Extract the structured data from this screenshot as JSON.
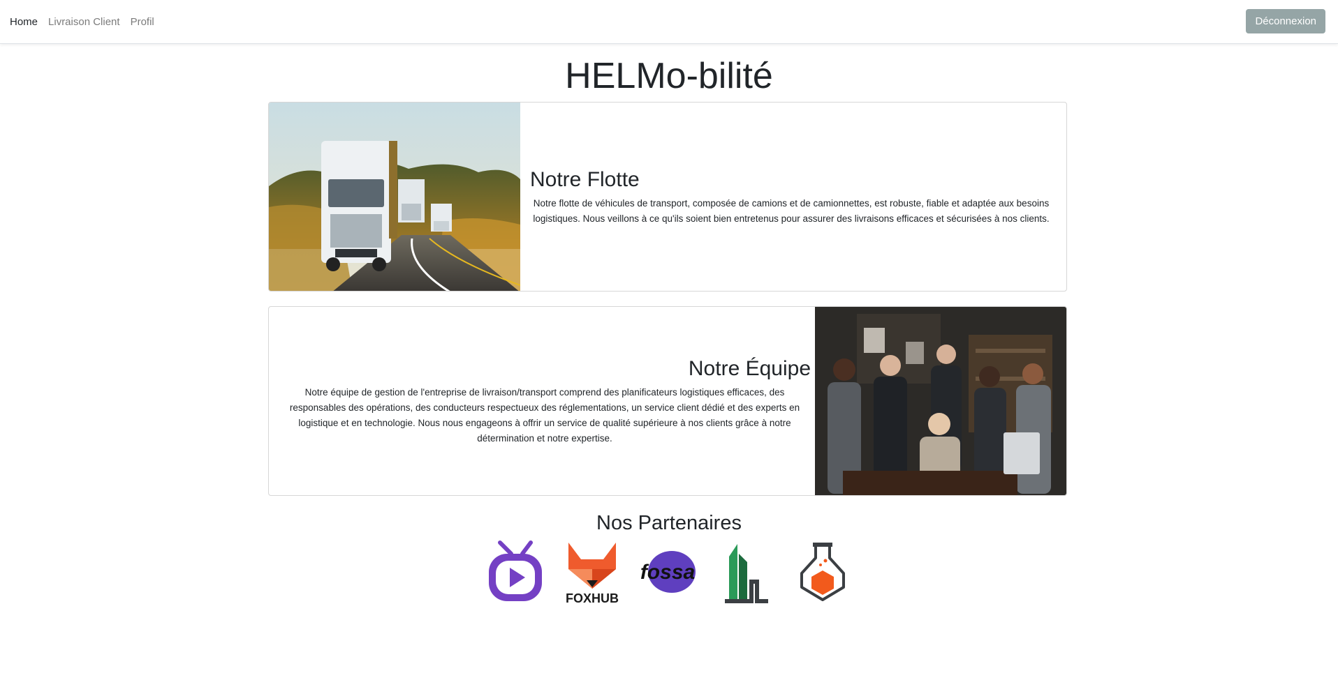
{
  "nav": {
    "links": [
      "Home",
      "Livraison Client",
      "Profil"
    ],
    "active": "Home",
    "logout_label": "Déconnexion"
  },
  "page": {
    "title": "HELMo-bilité"
  },
  "fleet": {
    "title": "Notre Flotte",
    "text": "Notre flotte de véhicules de transport, composée de camions et de camionnettes, est robuste, fiable et adaptée aux besoins logistiques. Nous veillons à ce qu'ils soient bien entretenus pour assurer des livraisons efficaces et sécurisées à nos clients."
  },
  "team": {
    "title": "Notre Équipe",
    "text": "Notre équipe de gestion de l'entreprise de livraison/transport comprend des planificateurs logistiques efficaces, des responsables des opérations, des conducteurs respectueux des réglementations, un service client dédié et des experts en logistique et en technologie. Nous nous engageons à offrir un service de qualité supérieure à nos clients grâce à notre détermination et notre expertise."
  },
  "partners": {
    "title": "Nos Partenaires",
    "logos": [
      {
        "icon": "tv-play-logo-icon"
      },
      {
        "icon": "foxhub-logo-icon",
        "wordmark": "FOXHUB"
      },
      {
        "icon": "fossa-logo-icon",
        "wordmark": "fossa"
      },
      {
        "icon": "green-building-logo-icon"
      },
      {
        "icon": "flask-logo-icon"
      }
    ]
  },
  "colors": {
    "logout_bg": "#95a5a6",
    "text": "#212529",
    "nav_muted": "#7b7b7b",
    "tv_purple": "#7440c4",
    "fox_orange": "#ef5b2d",
    "fossa_purple": "#5f3fbf",
    "building_green": "#2a9a58",
    "flask_orange": "#f25a1c"
  }
}
